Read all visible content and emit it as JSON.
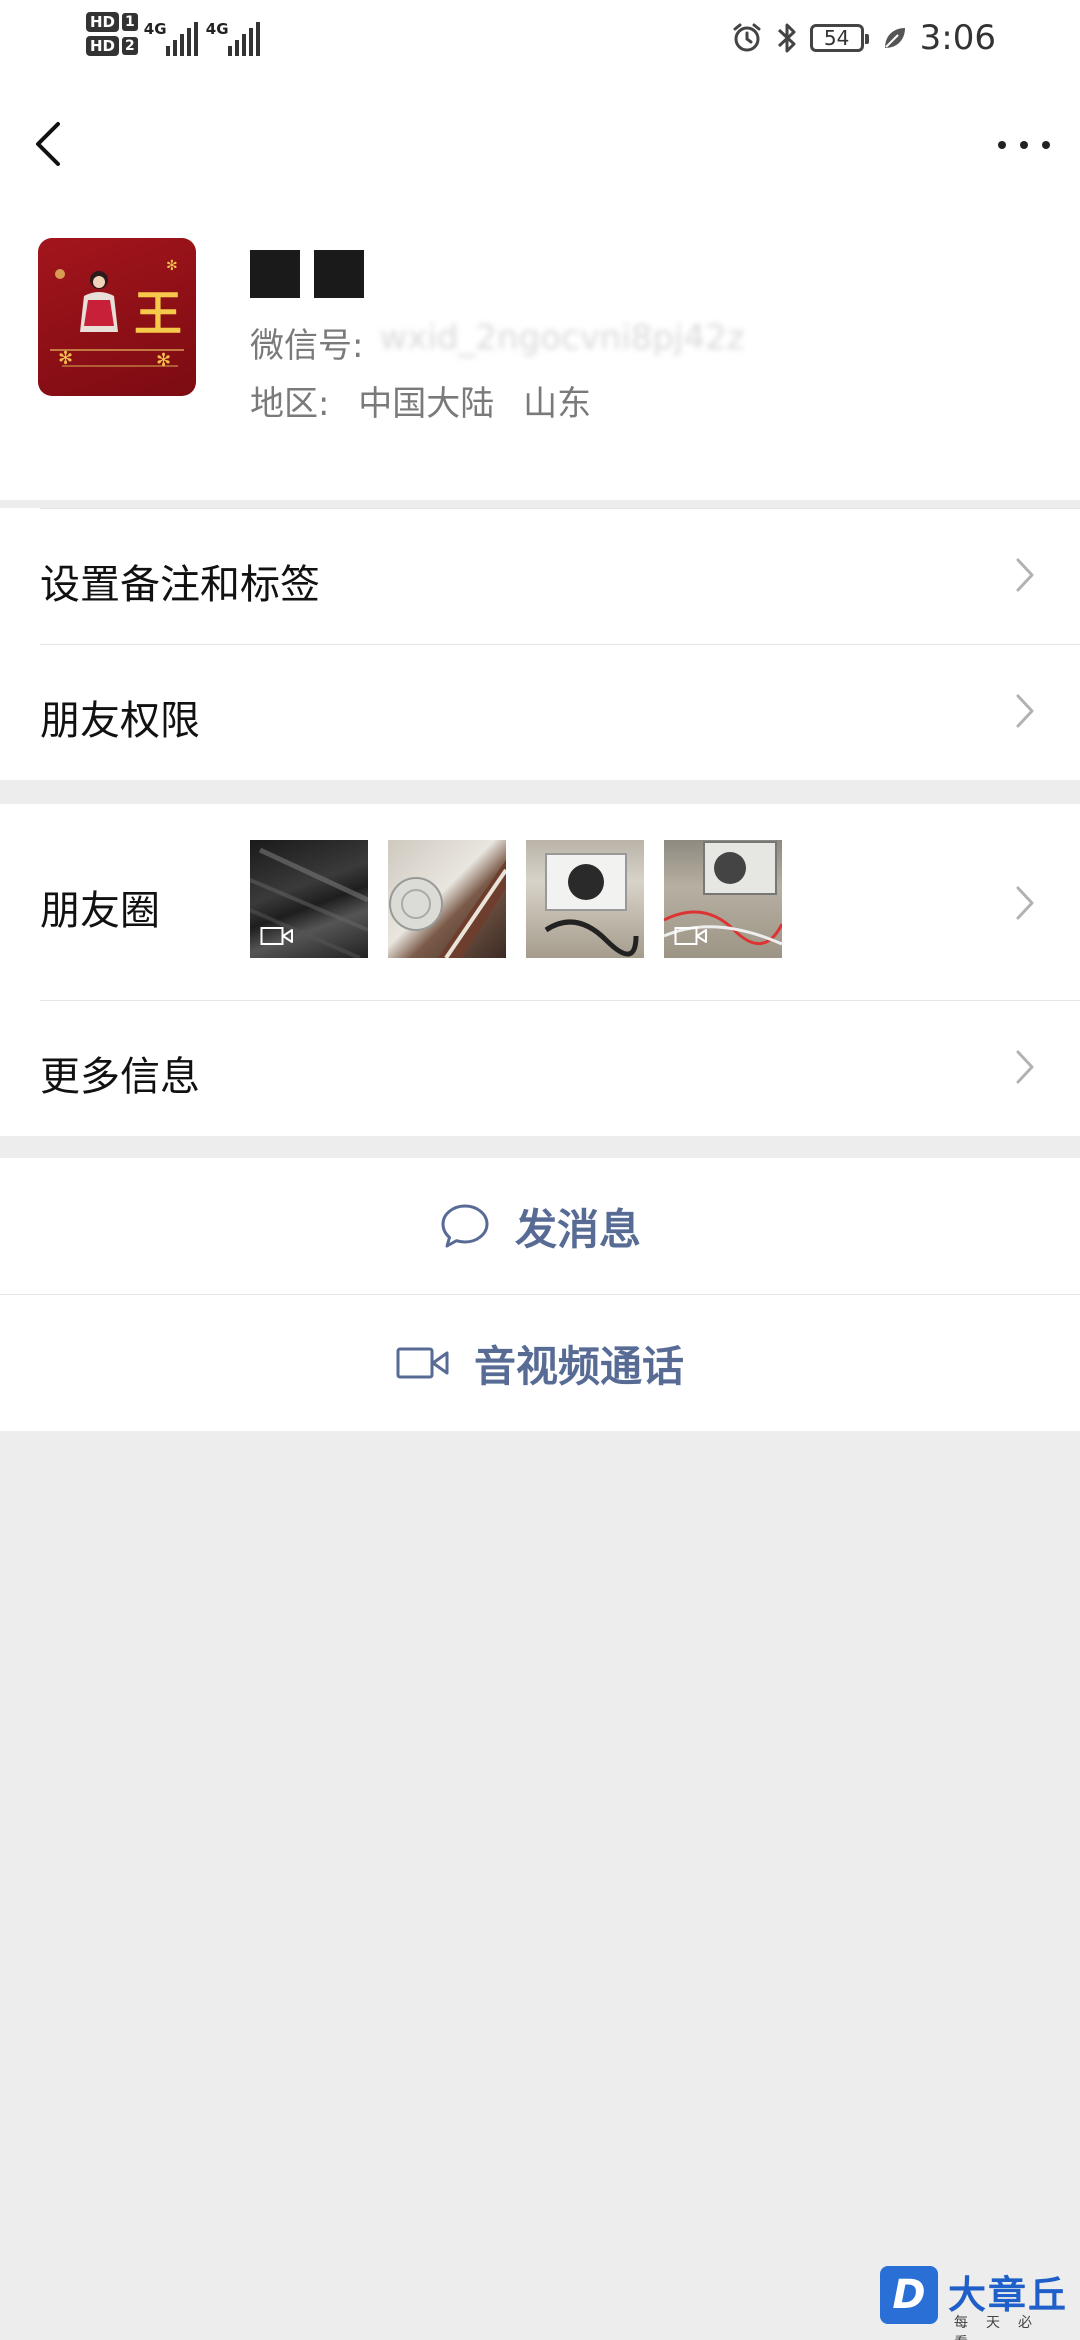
{
  "status_bar": {
    "sim1": "HD",
    "sim1_num": "1",
    "sim2": "HD",
    "sim2_num": "2",
    "net1": "4G",
    "net2": "4G",
    "battery": "54",
    "time": "3:06"
  },
  "profile": {
    "wechat_id_label": "微信号:",
    "wechat_id_value": "wxid_2ngocvni8pj42z",
    "region_label": "地区:",
    "region_country": "中国大陆",
    "region_province": "山东",
    "avatar_text": "王"
  },
  "menu": {
    "remark_tags": "设置备注和标签",
    "friend_permissions": "朋友权限",
    "moments": "朋友圈",
    "more_info": "更多信息"
  },
  "actions": {
    "send_message": "发消息",
    "av_call": "音视频通话"
  },
  "watermark": {
    "logo": "D",
    "title": "大章丘",
    "subtitle": "每天必看"
  },
  "colors": {
    "action_text": "#576b95",
    "avatar_bg": "#a3151c"
  }
}
